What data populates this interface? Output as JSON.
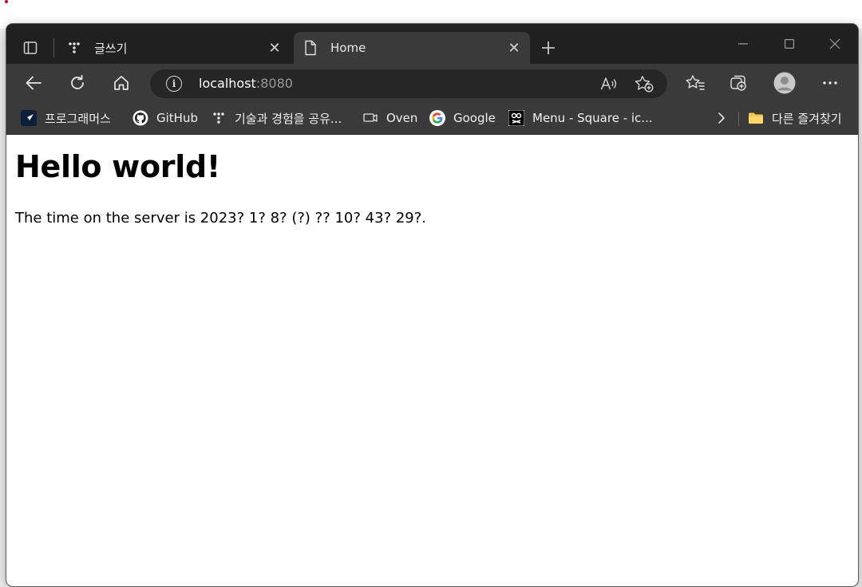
{
  "tabs": [
    {
      "label": "글쓰기",
      "active": false
    },
    {
      "label": "Home",
      "active": true
    }
  ],
  "address": {
    "host": "localhost",
    "port": ":8080"
  },
  "bookmarks": [
    {
      "label": "프로그래머스",
      "icon": "programmers-icon"
    },
    {
      "label": "GitHub",
      "icon": "github-icon"
    },
    {
      "label": "기술과 경험을 공유...",
      "icon": "tistory-icon"
    },
    {
      "label": "Oven",
      "icon": "oven-icon"
    },
    {
      "label": "Google",
      "icon": "google-icon"
    },
    {
      "label": "Menu - Square - ic...",
      "icon": "icons8-icon"
    }
  ],
  "other_favorites": "다른 즐겨찾기",
  "page": {
    "heading": "Hello world!",
    "body": "The time on the server is 2023? 1? 8? (?) ?? 10? 43? 29?."
  },
  "colors": {
    "chrome_dark": "#202020",
    "chrome": "#3a3a3a",
    "address": "#262626"
  }
}
